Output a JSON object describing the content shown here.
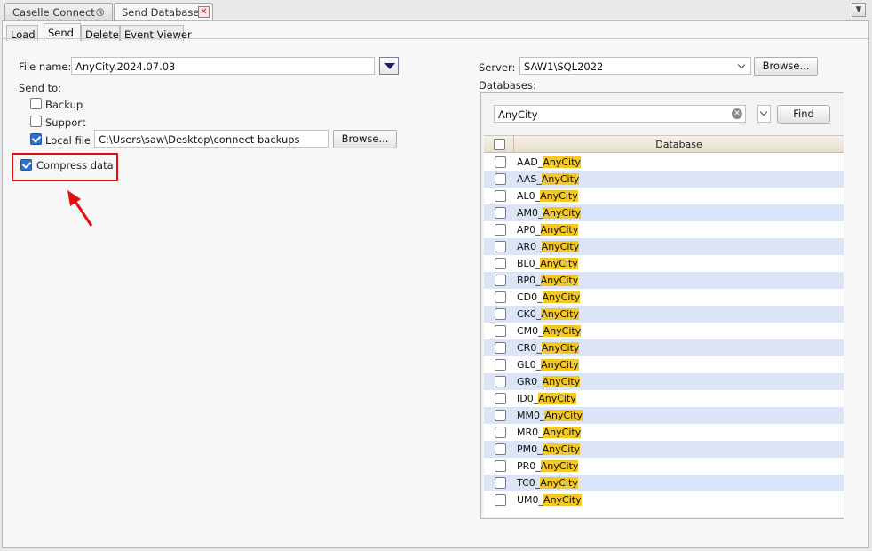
{
  "doc_tabs": [
    {
      "label": "Caselle Connect®"
    },
    {
      "label": "Send Databases"
    }
  ],
  "sub_tabs": [
    "Load",
    "Send",
    "Delete",
    "Event Viewer"
  ],
  "left": {
    "file_name_label": "File name:",
    "file_name_value": "AnyCity.2024.07.03",
    "send_to_label": "Send to:",
    "backup_label": "Backup",
    "backup_checked": false,
    "support_label": "Support",
    "support_checked": false,
    "local_file_label": "Local file",
    "local_file_checked": true,
    "local_file_path": "C:\\Users\\saw\\Desktop\\connect backups",
    "browse_label": "Browse...",
    "compress_label": "Compress data",
    "compress_checked": true
  },
  "right": {
    "server_label": "Server:",
    "server_value": "SAW1\\SQL2022",
    "browse_label": "Browse...",
    "databases_label": "Databases:",
    "search_value": "AnyCity",
    "find_label": "Find",
    "column_header": "Database",
    "highlight_term": "AnyCity",
    "rows": [
      {
        "prefix": "AAD_",
        "suffix": "AnyCity"
      },
      {
        "prefix": "AAS_",
        "suffix": "AnyCity"
      },
      {
        "prefix": "AL0_",
        "suffix": "AnyCity"
      },
      {
        "prefix": "AM0_",
        "suffix": "AnyCity"
      },
      {
        "prefix": "AP0_",
        "suffix": "AnyCity"
      },
      {
        "prefix": "AR0_",
        "suffix": "AnyCity"
      },
      {
        "prefix": "BL0_",
        "suffix": "AnyCity"
      },
      {
        "prefix": "BP0_",
        "suffix": "AnyCity"
      },
      {
        "prefix": "CD0_",
        "suffix": "AnyCity"
      },
      {
        "prefix": "CK0_",
        "suffix": "AnyCity"
      },
      {
        "prefix": "CM0_",
        "suffix": "AnyCity"
      },
      {
        "prefix": "CR0_",
        "suffix": "AnyCity"
      },
      {
        "prefix": "GL0_",
        "suffix": "AnyCity"
      },
      {
        "prefix": "GR0_",
        "suffix": "AnyCity"
      },
      {
        "prefix": "ID0_",
        "suffix": "AnyCity"
      },
      {
        "prefix": "MM0_",
        "suffix": "AnyCity"
      },
      {
        "prefix": "MR0_",
        "suffix": "AnyCity"
      },
      {
        "prefix": "PM0_",
        "suffix": "AnyCity"
      },
      {
        "prefix": "PR0_",
        "suffix": "AnyCity"
      },
      {
        "prefix": "TC0_",
        "suffix": "AnyCity"
      },
      {
        "prefix": "UM0_",
        "suffix": "AnyCity"
      }
    ]
  },
  "colors": {
    "highlight": "#f5c825",
    "alt_row": "#dbe5f5",
    "annotation": "#e01010",
    "check": "#2f6fd0"
  }
}
